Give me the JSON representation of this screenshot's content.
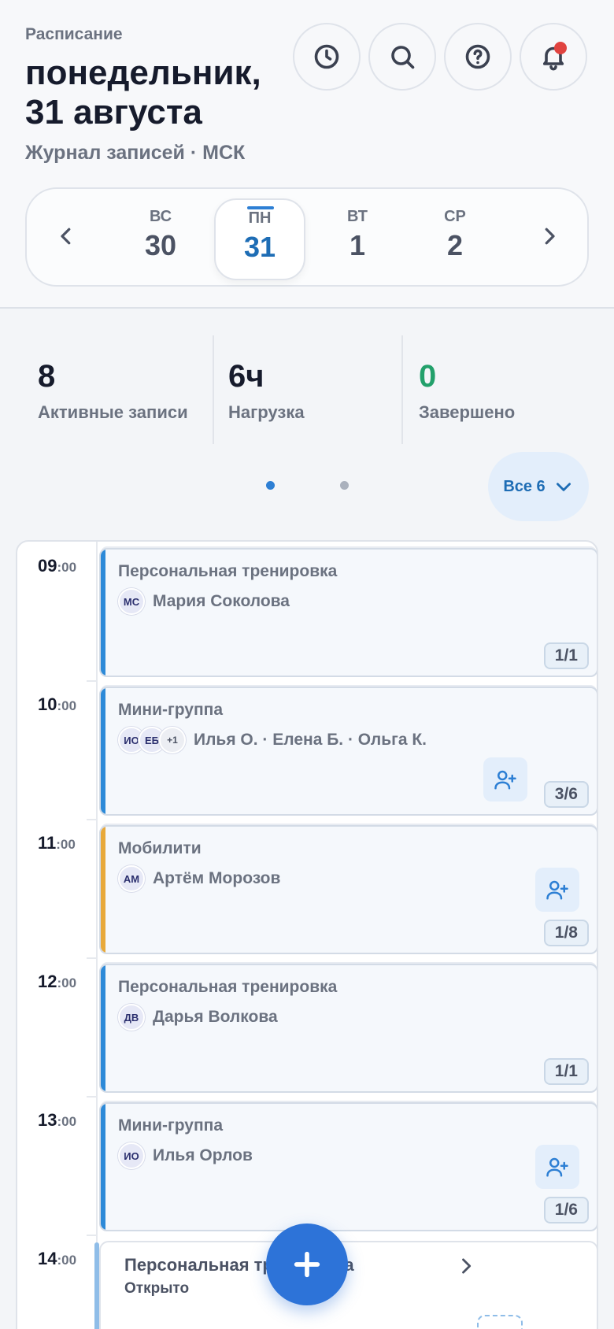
{
  "header": {
    "eyebrow": "Расписание",
    "title": "понедельник, 31 августа",
    "subtitle": "Журнал записей · МСК",
    "buttons": [
      {
        "icon": "clock-icon"
      },
      {
        "icon": "search-icon"
      },
      {
        "icon": "help-icon"
      },
      {
        "icon": "bell-icon",
        "has_notification": true
      }
    ]
  },
  "datebar": {
    "days": [
      {
        "dow": "ВС",
        "num": "30",
        "active": false
      },
      {
        "dow": "ПН",
        "num": "31",
        "active": true
      },
      {
        "dow": "ВТ",
        "num": "1",
        "active": false
      },
      {
        "dow": "СР",
        "num": "2",
        "active": false
      }
    ]
  },
  "stats": [
    {
      "value": "8",
      "label": "Активные записи",
      "color": "#161b2c"
    },
    {
      "value": "6ч",
      "label": "Нагрузка",
      "color": "#161b2c"
    },
    {
      "value": "0",
      "label": "Завершено",
      "color": "#22a06b"
    }
  ],
  "pager": {
    "pages": 2,
    "active": 1
  },
  "filter": {
    "label": "Все 6"
  },
  "timeline": {
    "slots": [
      {
        "hour": "09",
        "minutes": ":00"
      },
      {
        "hour": "10",
        "minutes": ":00"
      },
      {
        "hour": "11",
        "minutes": ":00"
      },
      {
        "hour": "12",
        "minutes": ":00"
      },
      {
        "hour": "13",
        "minutes": ":00"
      },
      {
        "hour": "14",
        "minutes": ":00"
      }
    ],
    "sessions": [
      {
        "title": "Персональная тренировка",
        "avatars": [
          "МС"
        ],
        "names": "Мария Соколова",
        "capacity": "1/1",
        "accent": "#2d8ad8",
        "add_button": false
      },
      {
        "title": "Мини-группа",
        "avatars": [
          "ИО",
          "ЕБ",
          "+1"
        ],
        "names": "Илья О. · Елена Б. · Ольга К.",
        "capacity": "3/6",
        "accent": "#2d8ad8",
        "add_button": true
      },
      {
        "title": "Мобилити",
        "avatars": [
          "АМ"
        ],
        "names": "Артём Морозов",
        "capacity": "1/8",
        "accent": "#e8a93a",
        "add_button": true
      },
      {
        "title": "Персональная тренировка",
        "avatars": [
          "ДВ"
        ],
        "names": "Дарья Волкова",
        "capacity": "1/1",
        "accent": "#2d8ad8",
        "add_button": false
      },
      {
        "title": "Мини-группа",
        "avatars": [
          "ИО"
        ],
        "names": "Илья Орлов",
        "capacity": "1/6",
        "accent": "#2d8ad8",
        "add_button": true
      }
    ],
    "open_slot": {
      "title": "Персональная тренировка",
      "status": "Открыто"
    }
  }
}
